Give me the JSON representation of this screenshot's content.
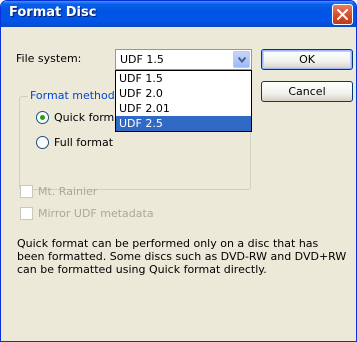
{
  "window": {
    "title": "Format Disc"
  },
  "form": {
    "file_system_label": "File system:",
    "file_system_value": "UDF 1.5",
    "ok_label": "OK",
    "cancel_label": "Cancel",
    "format_method_legend": "Format method",
    "quick_format_label": "Quick form",
    "full_format_label": "Full format",
    "mt_rainier_label": "Mt. Rainier",
    "mirror_udf_label": "Mirror UDF metadata",
    "description": "Quick format can be performed only on a disc that has been formatted. Some discs such as DVD-RW and DVD+RW can be formatted using Quick format directly."
  },
  "dropdown": {
    "options": [
      "UDF 1.5",
      "UDF 2.0",
      "UDF 2.01",
      "UDF 2.5"
    ],
    "highlighted_index": 3
  },
  "colors": {
    "titlebar": "#0054E3",
    "selection": "#316AC5",
    "legend": "#0046D5"
  }
}
